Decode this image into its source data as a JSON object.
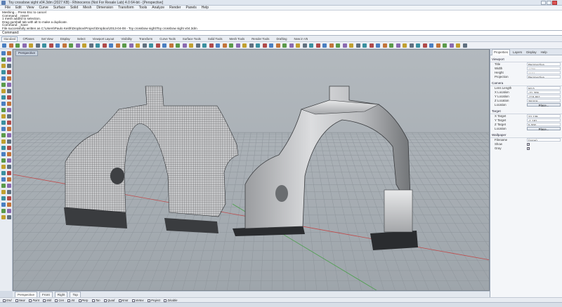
{
  "window": {
    "title": "Toy crossbow sight v04.3dm (2027 KB) - Rhinoceros (Not For Resale Lab) 4.0 64-bit - [Perspective]"
  },
  "menu": [
    "File",
    "Edit",
    "View",
    "Curve",
    "Surface",
    "Solid",
    "Mesh",
    "Dimension",
    "Transform",
    "Tools",
    "Analyze",
    "Render",
    "Panels",
    "Help"
  ],
  "history": [
    "Meshing... Press Esc to cancel",
    "Command: _Insert",
    "1 mesh added to selection.",
    "Drag gumball tab with alt to make a duplicate.",
    "Command: _Save",
    "File successfully written as C:\\Users\\Paulo Keith\\Dropbox\\Project\\Dropbox\\2013-04-08 - Toy crossbow sight\\Toy crossbow sight v04.3dm"
  ],
  "command": {
    "label": "Command:"
  },
  "toolbar_tabs": [
    "Standard",
    "CPlanes",
    "Set View",
    "Display",
    "Select",
    "Viewport Layout",
    "Visibility",
    "Transform",
    "Curve Tools",
    "Surface Tools",
    "Solid Tools",
    "Mesh Tools",
    "Render Tools",
    "Drafting",
    "New in V5"
  ],
  "viewport": {
    "label": "Perspective"
  },
  "view_tabs": [
    "Perspective",
    "Front",
    "Right",
    "Top"
  ],
  "osnaps": [
    "End",
    "Near",
    "Point",
    "Mid",
    "Cen",
    "Int",
    "Perp",
    "Tan",
    "Quad",
    "Knot",
    "Vertex",
    "Project",
    "Disable"
  ],
  "panel": {
    "tabs": [
      "Properties",
      "Layers",
      "Display",
      "Help"
    ],
    "sections": {
      "viewport": "Viewport",
      "camera": "Camera",
      "target": "Target",
      "wallpaper": "Wallpaper"
    },
    "viewport_rows": [
      {
        "label": "Title",
        "value": "Perspective"
      },
      {
        "label": "Width",
        "value": "1738"
      },
      {
        "label": "Height",
        "value": "1121"
      },
      {
        "label": "Projection",
        "value": "Perspective"
      }
    ],
    "camera_rows": [
      {
        "label": "Lens Length",
        "value": "50.0"
      },
      {
        "label": "X Location",
        "value": "-21.205"
      },
      {
        "label": "Y Location",
        "value": "-119.861"
      },
      {
        "label": "Z Location",
        "value": "38.516"
      }
    ],
    "camera_button": {
      "label": "Location",
      "value": "Place..."
    },
    "target_rows": [
      {
        "label": "X Target",
        "value": "22.139"
      },
      {
        "label": "Y Target",
        "value": "-1.181"
      },
      {
        "label": "Z Target",
        "value": "5.000"
      }
    ],
    "target_button": {
      "label": "Location",
      "value": "Place..."
    },
    "wallpaper_rows": [
      {
        "label": "Filename",
        "value": "(none)"
      },
      {
        "label": "Show",
        "check": true
      },
      {
        "label": "Gray",
        "check": true
      }
    ]
  },
  "colors": {
    "viewport_bg": "#a8aeb3",
    "accent": "#5b7fb3",
    "axis_red": "#c04a4a",
    "mesh_dark": "#2a2c2f"
  }
}
